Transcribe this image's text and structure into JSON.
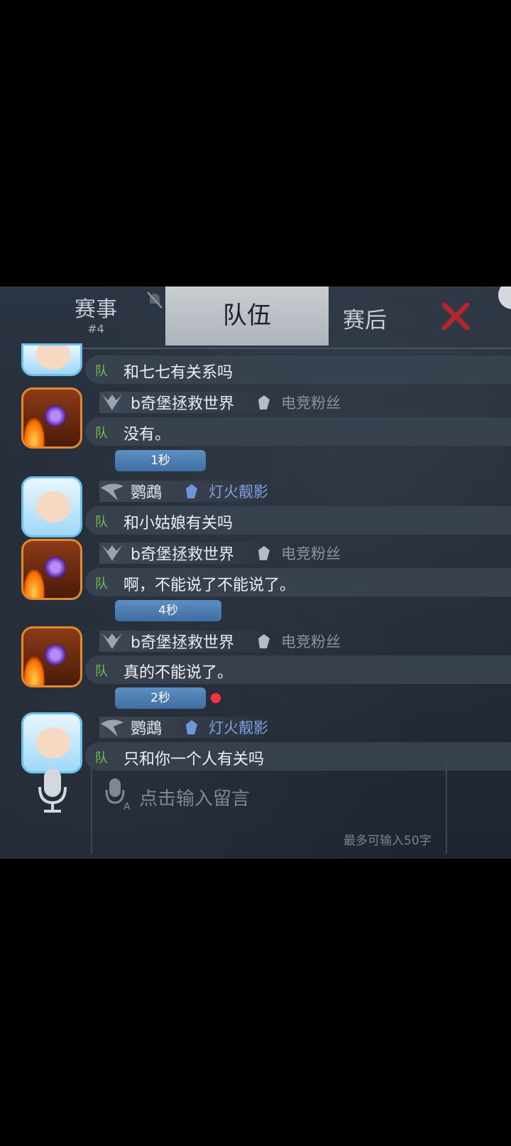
{
  "header": {
    "tabs": [
      {
        "label": "赛事",
        "sub": "#4"
      },
      {
        "label": "队伍"
      },
      {
        "label": "赛后"
      }
    ]
  },
  "messages": [
    {
      "name": "",
      "title": "",
      "team": "队",
      "text": "和七七有关系吗"
    },
    {
      "name": "b奇堡拯救世界",
      "title": "电竞粉丝",
      "team": "队",
      "text": "没有。"
    },
    {
      "name": "鹦鵡",
      "title": "灯火靓影",
      "team": "队",
      "text": "和小姑娘有关吗"
    },
    {
      "name": "b奇堡拯救世界",
      "title": "电竞粉丝",
      "team": "队",
      "text": "啊，不能说了不能说了。"
    },
    {
      "name": "b奇堡拯救世界",
      "title": "电竞粉丝",
      "team": "队",
      "text": "真的不能说了。"
    },
    {
      "name": "鹦鵡",
      "title": "灯火靓影",
      "team": "队",
      "text": "只和你一个人有关吗"
    }
  ],
  "times": [
    "1秒",
    "4秒",
    "2秒"
  ],
  "input": {
    "placeholder": "点击输入留言",
    "limit": "最多可输入50字"
  },
  "colors": {
    "team_tag": "#6fbf4e",
    "time_pill": "#4b7db1",
    "active_tab": "#c0c5cb",
    "red_dot": "#ff3040"
  }
}
